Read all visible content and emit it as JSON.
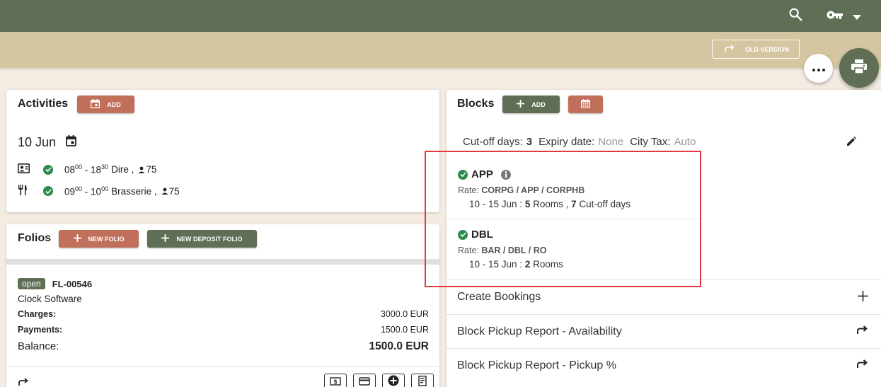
{
  "header": {
    "search_icon": "search-icon",
    "key_icon": "key-icon",
    "menu_icon": "caret-down-icon"
  },
  "subheader": {
    "old_version_label": "OLD VERSION"
  },
  "activities": {
    "title": "Activities",
    "add_label": "ADD",
    "date": "10 Jun",
    "items": [
      {
        "start_h": "08",
        "start_m": "00",
        "end_h": "18",
        "end_m": "30",
        "name": "Dire ,",
        "guests": "75"
      },
      {
        "start_h": "09",
        "start_m": "00",
        "end_h": "10",
        "end_m": "00",
        "name": "Brasserie ,",
        "guests": "75"
      }
    ]
  },
  "folios": {
    "title": "Folios",
    "new_folio_label": "NEW FOLIO",
    "new_deposit_label": "NEW DEPOSIT FOLIO",
    "status": "open",
    "number": "FL-00546",
    "company": "Clock Software",
    "charges_label": "Charges:",
    "charges_value": "3000.0 EUR",
    "payments_label": "Payments:",
    "payments_value": "1500.0 EUR",
    "balance_label": "Balance:",
    "balance_value": "1500.0 EUR"
  },
  "blocks": {
    "title": "Blocks",
    "add_label": "ADD",
    "cutoff_label": "Cut-off days:",
    "cutoff_value": "3",
    "expiry_label": "Expiry date:",
    "expiry_value": "None",
    "citytax_label": "City Tax:",
    "citytax_value": "Auto",
    "rates": [
      {
        "code": "APP",
        "rate_label": "Rate:",
        "rate": "CORPG / APP / CORPHB",
        "dates": "10 - 15 Jun :",
        "rooms": "5",
        "rooms_label": "Rooms ,",
        "cutoff": "7",
        "cutoff_label": "Cut-off days"
      },
      {
        "code": "DBL",
        "rate_label": "Rate:",
        "rate": "BAR / DBL / RO",
        "dates": "10 - 15 Jun :",
        "rooms": "2",
        "rooms_label": "Rooms"
      }
    ],
    "actions": [
      "Create Bookings",
      "Block Pickup Report - Availability",
      "Block Pickup Report - Pickup %"
    ]
  }
}
